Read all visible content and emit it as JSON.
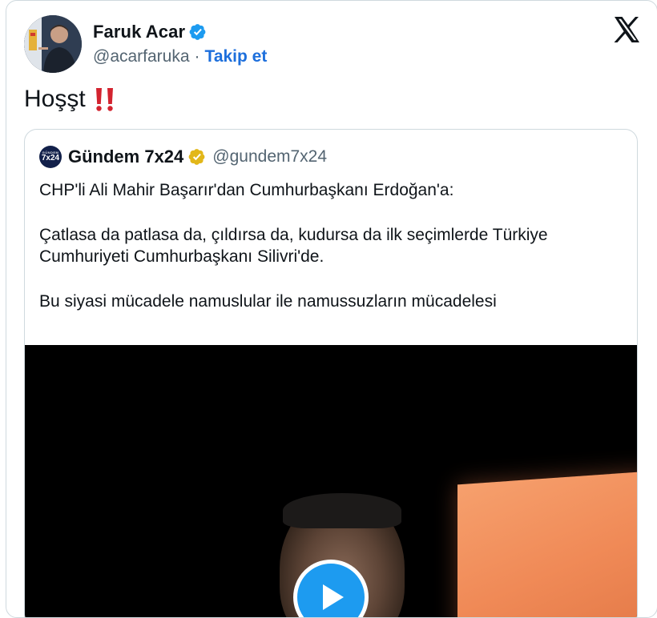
{
  "tweet": {
    "author_name": "Faruk Acar",
    "author_handle": "@acarfaruka",
    "separator": "·",
    "follow_label": "Takip et",
    "text": "Hoşşt",
    "emoji": "double-exclamation-icon"
  },
  "quoted": {
    "author_name": "Gündem 7x24",
    "author_handle": "@gundem7x24",
    "avatar_text_small": "GÜNDEM",
    "avatar_text_main": "7x24",
    "lines": [
      "CHP'li Ali Mahir Başarır'dan Cumhurbaşkanı Erdoğan'a:",
      "Çatlasa da patlasa da, çıldırsa da, kudursa da ilk seçimlerde Türkiye Cumhuriyeti Cumhurbaşkanı Silivri'de.",
      "Bu siyasi mücadele namuslular ile namussuzların mücadelesi"
    ]
  },
  "icons": {
    "verified_blue": "verified-badge-blue-icon",
    "verified_gold": "verified-badge-gold-icon",
    "logo": "x-logo-icon",
    "play": "play-icon"
  },
  "colors": {
    "link": "#1d6fdc",
    "verified_blue": "#1d9bf0",
    "verified_gold": "#e2b719",
    "border": "#cfd9de",
    "muted": "#536471",
    "emoji_red": "#d3232f"
  }
}
